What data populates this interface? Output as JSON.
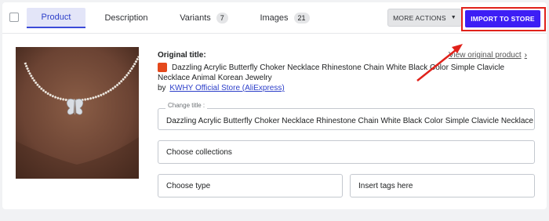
{
  "tabs": [
    {
      "label": "Product",
      "active": true
    },
    {
      "label": "Description"
    },
    {
      "label": "Variants",
      "count": "7"
    },
    {
      "label": "Images",
      "count": "21"
    }
  ],
  "actions": {
    "more_actions": "MORE ACTIONS",
    "import": "IMPORT TO STORE"
  },
  "product": {
    "original_title_label": "Original title:",
    "view_original": "View original product",
    "title": "Dazzling Acrylic Butterfly Choker Necklace Rhinestone Chain White Black Color Simple Clavicle Necklace Animal Korean Jewelry",
    "by_prefix": "by",
    "store_name": "KWHY Official Store (AliExpress)"
  },
  "form": {
    "change_title_label": "Change title :",
    "change_title_value": "Dazzling Acrylic Butterfly Choker Necklace Rhinestone Chain White Black Color Simple Clavicle Necklace Animal Korean Jewelry",
    "collections_placeholder": "Choose collections",
    "type_placeholder": "Choose type",
    "tags_placeholder": "Insert tags here"
  },
  "colors": {
    "accent": "#3d1ef5",
    "highlight": "#e0221b",
    "link": "#2c3ec9"
  }
}
